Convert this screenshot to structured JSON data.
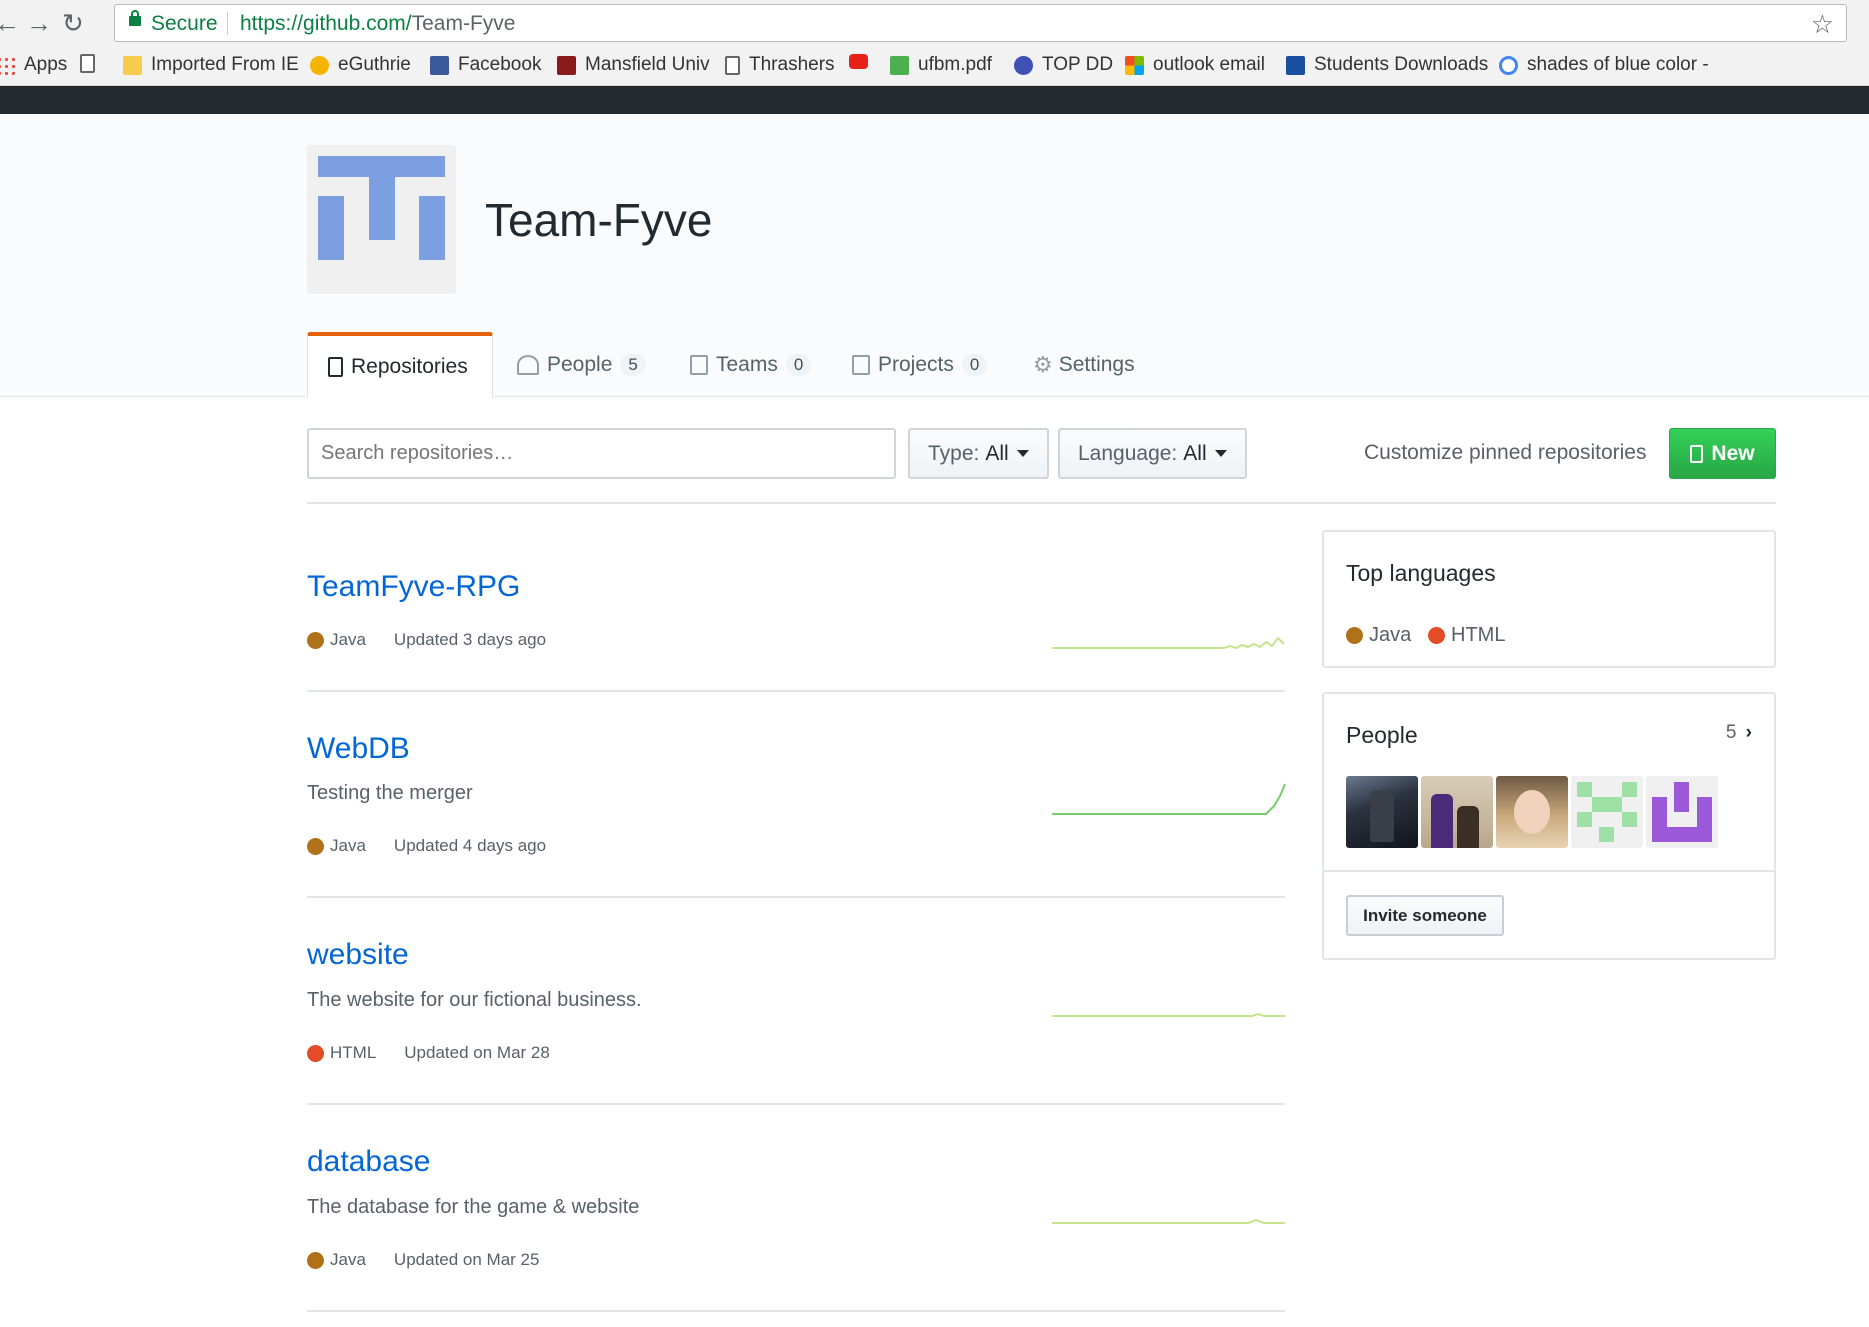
{
  "browser": {
    "secure_label": "Secure",
    "url_host": "https://github.com/",
    "url_path": "Team-Fyve",
    "bookmarks": [
      {
        "label": "Apps",
        "icon": "apps-grid-icon",
        "color": "#e8453c"
      },
      {
        "label": "",
        "icon": "page-icon",
        "color": "#ffffff"
      },
      {
        "label": "Imported From IE",
        "icon": "folder-icon",
        "color": "#f7cb4d"
      },
      {
        "label": "eGuthrie",
        "icon": "eguthrie-icon",
        "color": "#f4b400"
      },
      {
        "label": "Facebook",
        "icon": "facebook-icon",
        "color": "#3b5998"
      },
      {
        "label": "Mansfield Univ",
        "icon": "mansfield-icon",
        "color": "#8b1a1a"
      },
      {
        "label": "Thrashers",
        "icon": "page-icon",
        "color": "#ffffff"
      },
      {
        "label": "",
        "icon": "youtube-icon",
        "color": "#e62117"
      },
      {
        "label": "ufbm.pdf",
        "icon": "pdf-icon",
        "color": "#4caf50"
      },
      {
        "label": "TOP DD",
        "icon": "gear-icon",
        "color": "#3f51b5"
      },
      {
        "label": "outlook email",
        "icon": "microsoft-icon",
        "color": "#f25022"
      },
      {
        "label": "Students Downloads",
        "icon": "students-icon",
        "color": "#1a4fa0"
      },
      {
        "label": "shades of blue color -",
        "icon": "google-icon",
        "color": "#4285f4"
      }
    ]
  },
  "org": {
    "name": "Team-Fyve",
    "tabs": [
      {
        "label": "Repositories",
        "icon": "repo-icon",
        "count": ""
      },
      {
        "label": "People",
        "icon": "people-icon",
        "count": "5"
      },
      {
        "label": "Teams",
        "icon": "teams-icon",
        "count": "0"
      },
      {
        "label": "Projects",
        "icon": "projects-icon",
        "count": "0"
      },
      {
        "label": "Settings",
        "icon": "gear-icon",
        "count": ""
      }
    ]
  },
  "filters": {
    "search_placeholder": "Search repositories…",
    "type_label": "Type:",
    "type_value": "All",
    "language_label": "Language:",
    "language_value": "All",
    "customize_label": "Customize pinned repositories",
    "new_label": "New"
  },
  "repos": [
    {
      "name": "TeamFyve-RPG",
      "description": "",
      "language": "Java",
      "updated": "Updated 3 days ago"
    },
    {
      "name": "WebDB",
      "description": "Testing the merger",
      "language": "Java",
      "updated": "Updated 4 days ago"
    },
    {
      "name": "website",
      "description": "The website for our fictional business.",
      "language": "HTML",
      "updated": "Updated on Mar 28"
    },
    {
      "name": "database",
      "description": "The database for the game & website",
      "language": "Java",
      "updated": "Updated on Mar 25"
    }
  ],
  "sidebar": {
    "top_languages_title": "Top languages",
    "languages": [
      {
        "name": "Java",
        "color": "#b07219"
      },
      {
        "name": "HTML",
        "color": "#e34c26"
      }
    ],
    "people_title": "People",
    "people_count": "5",
    "invite_label": "Invite someone"
  },
  "colors": {
    "java": "#b07219",
    "html": "#e34c26",
    "link": "#0366d6",
    "accent_tab": "#e36209",
    "new_button": "#28a745",
    "sparkline": "#c6e48b"
  }
}
